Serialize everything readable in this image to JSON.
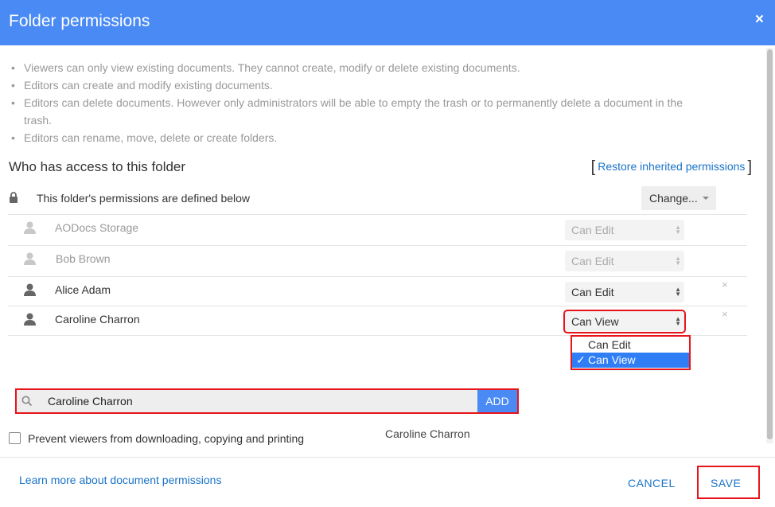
{
  "dialog": {
    "title": "Folder permissions",
    "close_label": "×"
  },
  "notes": [
    "Viewers can only view existing documents. They cannot create, modify or delete existing documents.",
    "Editors can create and modify existing documents.",
    "Editors can delete documents. However only administrators will be able to empty the trash or to permanently delete a document in the trash.",
    "Editors can rename, move, delete or create folders."
  ],
  "access": {
    "title": "Who has access to this folder",
    "restore_open": "[",
    "restore_link": "Restore inherited permissions",
    "restore_close": "]",
    "defined_text": "This folder's permissions are defined below",
    "change_button": "Change..."
  },
  "users": [
    {
      "name": "AODocs Storage",
      "permission": "Can Edit"
    },
    {
      "name": "Bob Brown",
      "permission": "Can Edit"
    },
    {
      "name": "Alice Adam",
      "permission": "Can Edit",
      "remove": "×"
    },
    {
      "name": "Caroline Charron",
      "permission": "Can View",
      "remove": "×"
    }
  ],
  "permission_dropdown": {
    "options": [
      "Can Edit",
      "Can View"
    ],
    "selected": "Can View",
    "check": "✓"
  },
  "add_user": {
    "value": "Caroline Charron",
    "button": "ADD",
    "suggestion": "Caroline Charron"
  },
  "prevent_label": "Prevent viewers from downloading, copying and printing",
  "footer": {
    "learn_more": "Learn more about document permissions",
    "cancel": "CANCEL",
    "save": "SAVE"
  },
  "colors": {
    "header": "#4a8af4",
    "highlight": "#e8141c",
    "link": "#1a73c7"
  }
}
